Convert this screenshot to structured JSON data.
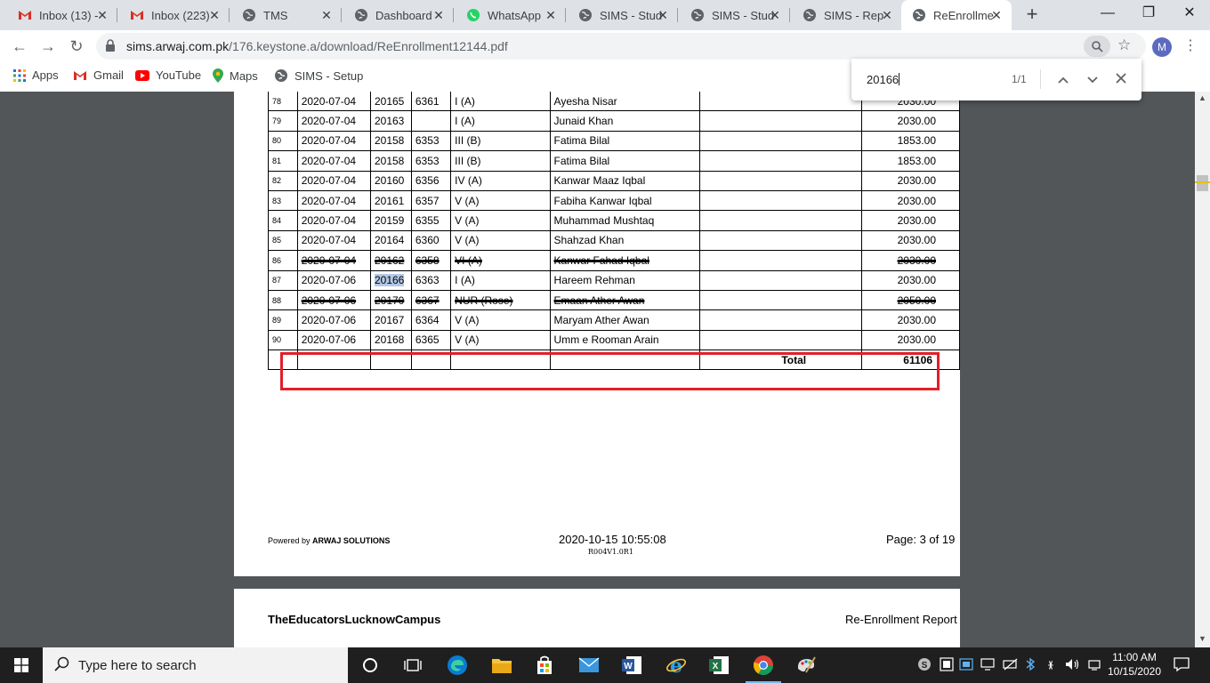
{
  "tabs": [
    {
      "label": "Inbox (13) -",
      "icon": "gmail-icon"
    },
    {
      "label": "Inbox (223)",
      "icon": "gmail-icon"
    },
    {
      "label": "TMS",
      "icon": "globe-icon"
    },
    {
      "label": "Dashboard",
      "icon": "globe-icon"
    },
    {
      "label": "WhatsApp",
      "icon": "whatsapp-icon"
    },
    {
      "label": "SIMS - Stud",
      "icon": "globe-icon"
    },
    {
      "label": "SIMS - Stud",
      "icon": "globe-icon"
    },
    {
      "label": "SIMS - Rep",
      "icon": "globe-icon"
    },
    {
      "label": "ReEnrollme",
      "icon": "globe-icon",
      "active": true
    }
  ],
  "toolbar": {
    "url_host": "sims.arwaj.com.pk",
    "url_path": "/176.keystone.a/download/ReEnrollment12144.pdf",
    "profile_initial": "M"
  },
  "bookmarks": {
    "apps": "Apps",
    "gmail": "Gmail",
    "youtube": "YouTube",
    "maps": "Maps",
    "sims_setup": "SIMS - Setup"
  },
  "find": {
    "query": "20166",
    "count": "1/1"
  },
  "report": {
    "rows": [
      {
        "sn": "78",
        "date": "2020-07-04",
        "reg": "20165",
        "id": "6361",
        "class": "I (A)",
        "name": "Ayesha Nisar",
        "amount": "2030.00"
      },
      {
        "sn": "79",
        "date": "2020-07-04",
        "reg": "20163",
        "id": "",
        "class": "I (A)",
        "name": "Junaid Khan",
        "amount": "2030.00"
      },
      {
        "sn": "80",
        "date": "2020-07-04",
        "reg": "20158",
        "id": "6353",
        "class": "III (B)",
        "name": "Fatima Bilal",
        "amount": "1853.00"
      },
      {
        "sn": "81",
        "date": "2020-07-04",
        "reg": "20158",
        "id": "6353",
        "class": "III (B)",
        "name": "Fatima Bilal",
        "amount": "1853.00"
      },
      {
        "sn": "82",
        "date": "2020-07-04",
        "reg": "20160",
        "id": "6356",
        "class": "IV (A)",
        "name": "Kanwar Maaz Iqbal",
        "amount": "2030.00"
      },
      {
        "sn": "83",
        "date": "2020-07-04",
        "reg": "20161",
        "id": "6357",
        "class": "V (A)",
        "name": "Fabiha Kanwar Iqbal",
        "amount": "2030.00"
      },
      {
        "sn": "84",
        "date": "2020-07-04",
        "reg": "20159",
        "id": "6355",
        "class": "V (A)",
        "name": "Muhammad Mushtaq",
        "amount": "2030.00"
      },
      {
        "sn": "85",
        "date": "2020-07-04",
        "reg": "20164",
        "id": "6360",
        "class": "V (A)",
        "name": "Shahzad Khan",
        "amount": "2030.00"
      },
      {
        "sn": "86",
        "date": "2020-07-04",
        "reg": "20162",
        "id": "6358",
        "class": "VI (A)",
        "name": "Kanwar Fahad Iqbal",
        "amount": "2030.00"
      },
      {
        "sn": "87",
        "date": "2020-07-06",
        "reg": "20166",
        "id": "6363",
        "class": "I (A)",
        "name": "Hareem Rehman",
        "amount": "2030.00"
      },
      {
        "sn": "88",
        "date": "2020-07-06",
        "reg": "20170",
        "id": "6367",
        "class": "NUR (Rose)",
        "name": "Emaan Ather Awan",
        "amount": "2050.00"
      },
      {
        "sn": "89",
        "date": "2020-07-06",
        "reg": "20167",
        "id": "6364",
        "class": "V (A)",
        "name": "Maryam Ather Awan",
        "amount": "2030.00"
      },
      {
        "sn": "90",
        "date": "2020-07-06",
        "reg": "20168",
        "id": "6365",
        "class": "V (A)",
        "name": "Umm e Rooman Arain",
        "amount": "2030.00"
      }
    ],
    "total_label": "Total",
    "total_value": "61106",
    "footer_powered": "Powered by",
    "footer_company": "ARWAJ SOLUTIONS",
    "footer_datetime": "2020-10-15 10:55:08",
    "footer_version": "R004V1.0R1",
    "footer_page": "Page: 3 of 19",
    "next_page_school": "TheEducatorsLucknowCampus",
    "next_page_report": "Re-Enrollment Report"
  },
  "taskbar": {
    "search_placeholder": "Type here to search",
    "time": "11:00 AM",
    "date": "10/15/2020"
  },
  "colors": {
    "highlight_box": "#e0202a",
    "find_highlight": "#b3c8e6"
  }
}
